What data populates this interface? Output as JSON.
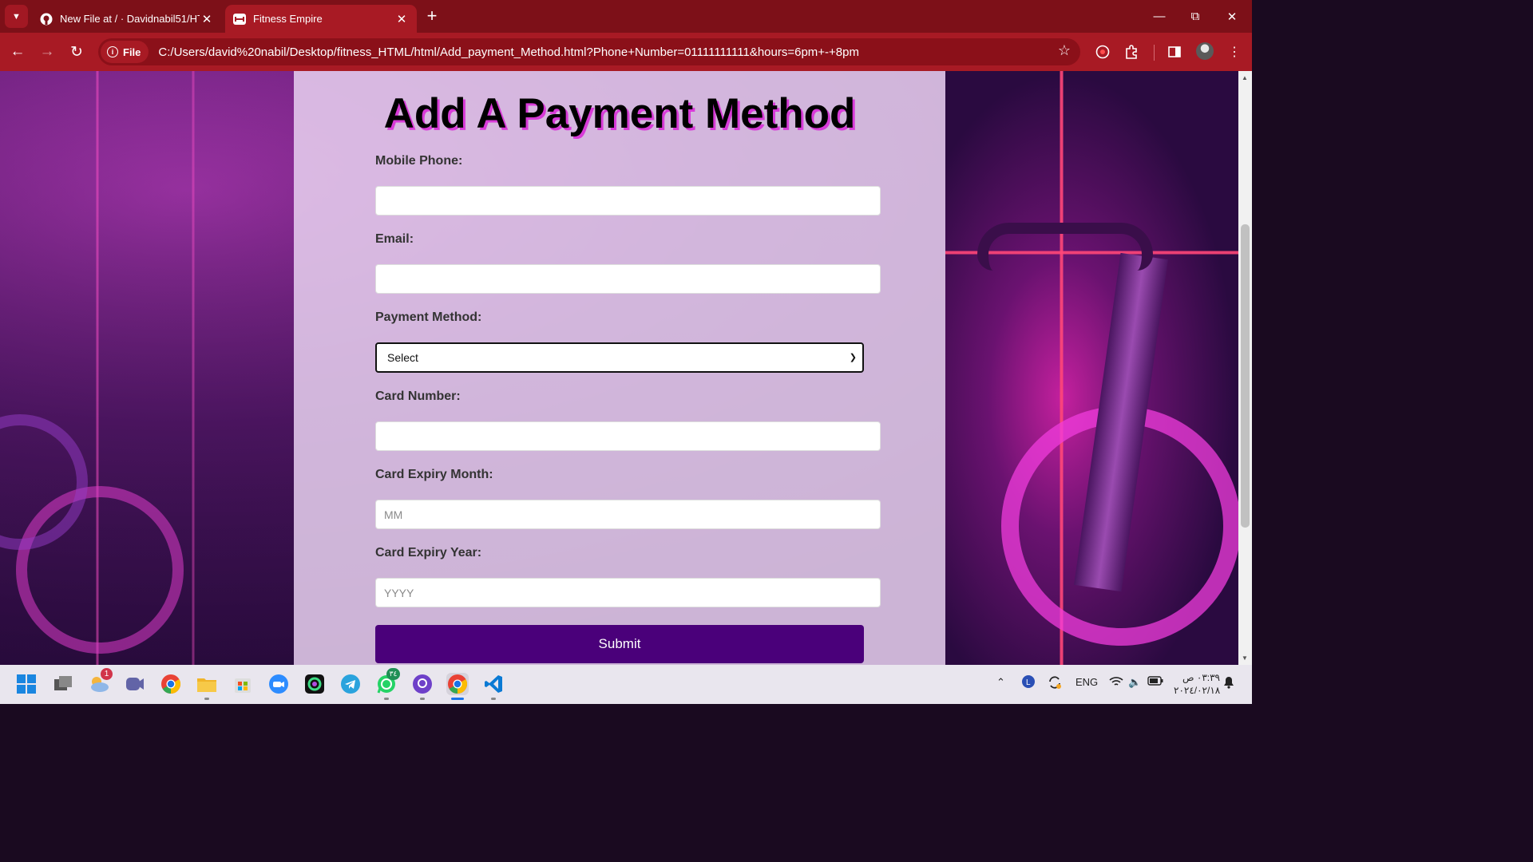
{
  "browser": {
    "tabs": [
      {
        "title": "New File at / · Davidnabil51/HT",
        "icon": "github-icon",
        "active": false
      },
      {
        "title": "Fitness Empire",
        "icon": "site-icon",
        "active": true
      }
    ],
    "address": {
      "chip_label": "File",
      "url": "C:/Users/david%20nabil/Desktop/fitness_HTML/html/Add_payment_Method.html?Phone+Number=01111111111&hours=6pm+-+8pm"
    },
    "colors": {
      "frame": "#7d1018",
      "toolbar": "#a81a24"
    }
  },
  "page": {
    "title": "Add A Payment Method",
    "fields": {
      "mobile_label": "Mobile Phone:",
      "mobile_value": "",
      "email_label": "Email:",
      "email_value": "",
      "payment_label": "Payment Method:",
      "payment_selected": "Select",
      "card_number_label": "Card Number:",
      "card_number_value": "",
      "expiry_month_label": "Card Expiry Month:",
      "expiry_month_placeholder": "MM",
      "expiry_year_label": "Card Expiry Year:",
      "expiry_year_placeholder": "YYYY"
    },
    "submit_label": "Submit",
    "colors": {
      "submit": "#4a007a",
      "title_shadow": "#d83ad8"
    }
  },
  "taskbar": {
    "badge_weather": "1",
    "badge_whatsapp": "٣٤",
    "tray": {
      "language": "ENG",
      "time": "٠٣:٣٩ ص",
      "date": "٢٠٢٤/٠٢/١٨"
    }
  }
}
